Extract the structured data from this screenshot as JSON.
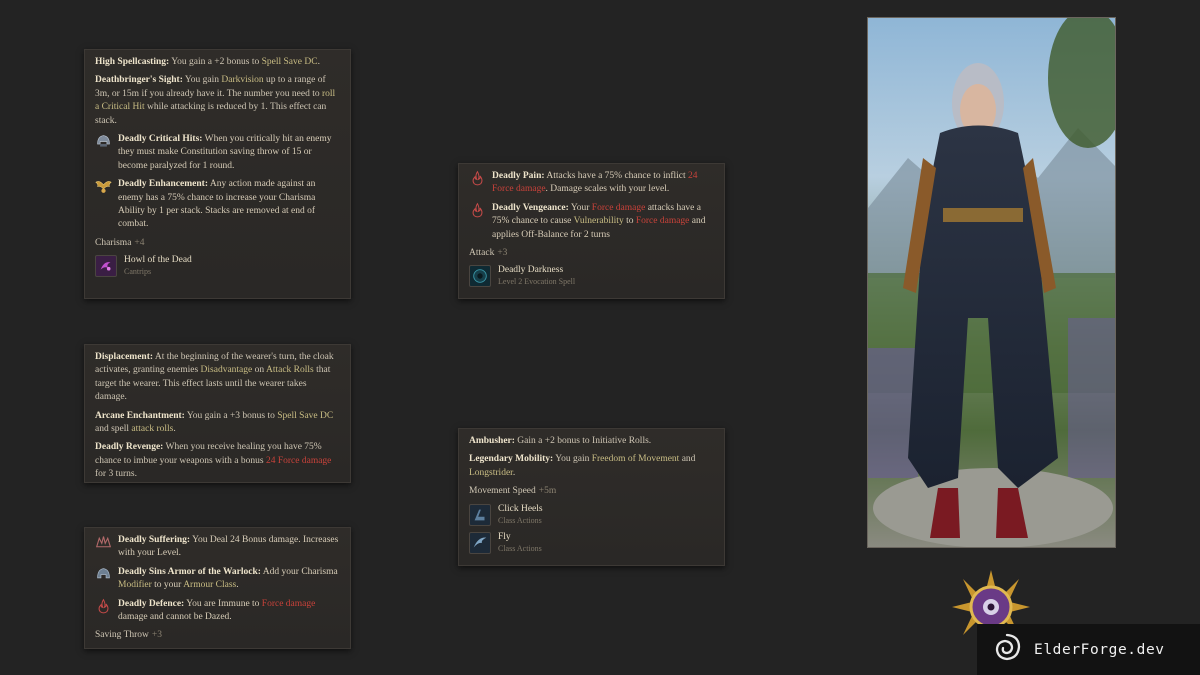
{
  "colors": {
    "background": "#232323",
    "panel": "#2c2a27",
    "highlight": "#c9bd84",
    "damage_red": "#c8423a",
    "title": "#efe5cc"
  },
  "panel1": {
    "high_spellcasting": {
      "name": "High Spellcasting:",
      "t1": " You gain a +2 bonus to ",
      "h1": "Spell Save DC",
      "t2": "."
    },
    "deathbringer": {
      "name": "Deathbringer's Sight:",
      "t1": " You gain ",
      "h1": "Darkvision",
      "t2": " up to a range of 3m, or 15m if you already have it. The number you need to ",
      "h2": "roll a Critical Hit",
      "t3": " while attacking is reduced by 1. This effect can stack."
    },
    "critical": {
      "icon": "helmet-icon",
      "name": "Deadly Critical Hits:",
      "t1": " When you critically hit an enemy they must make Constitution saving throw of 15 or become paralyzed for 1 round."
    },
    "enhancement": {
      "icon": "golden-wings-icon",
      "name": "Deadly Enhancement:",
      "t1": " Any action made against an enemy has a 75% chance to increase your Charisma Ability by 1 per stack. Stacks are removed at end of combat."
    },
    "stat": {
      "label": "Charisma",
      "bonus": "+4"
    },
    "spell": {
      "icon": "howl-of-the-dead-icon",
      "name": "Howl of the Dead",
      "sub": "Cantrips"
    }
  },
  "panel2": {
    "displacement": {
      "name": "Displacement:",
      "t1": " At the beginning of the wearer's turn, the cloak activates, granting enemies ",
      "h1": "Disadvantage",
      "t2": " on ",
      "h2": "Attack Rolls",
      "t3": " that target the wearer. This effect lasts until the wearer takes damage."
    },
    "arcane": {
      "name": "Arcane Enchantment:",
      "t1": " You gain a +3 bonus to ",
      "h1": "Spell Save DC",
      "t2": " and spell ",
      "h2": "attack rolls",
      "t3": "."
    },
    "revenge": {
      "name": "Deadly Revenge:",
      "t1": " When you receive healing you have 75% chance to imbue your weapons with a bonus ",
      "r1": "24 Force damage",
      "t2": " for 3 turns."
    }
  },
  "panel3": {
    "suffering": {
      "icon": "spiked-crown-icon",
      "name": "Deadly Suffering:",
      "t1": " You Deal 24 Bonus damage. Increases with your Level."
    },
    "sins": {
      "icon": "armor-helm-icon",
      "name": "Deadly Sins Armor of the Warlock:",
      "t1": " Add your Charisma ",
      "h1": "Modifier",
      "t2": " to your ",
      "h2": "Armour Class",
      "t3": "."
    },
    "defence": {
      "icon": "red-flame-icon",
      "name": "Deadly Defence:",
      "t1": " You are Immune to ",
      "r1": "Force damage",
      "t2": " damage and cannot be Dazed."
    },
    "stat": {
      "label": "Saving Throw",
      "bonus": "+3"
    }
  },
  "panel4": {
    "pain": {
      "icon": "red-flame-icon",
      "name": "Deadly Pain:",
      "t1": " Attacks have a 75% chance to inflict ",
      "r1": "24 Force damage",
      "t2": ". Damage scales with your level."
    },
    "vengeance": {
      "icon": "red-flame-icon",
      "name": "Deadly Vengeance:",
      "t1": " Your ",
      "r1": "Force damage",
      "t2": " attacks have a 75% chance to cause ",
      "h1": "Vulnerability",
      "t3": " to ",
      "r2": "Force damage",
      "t4": " and applies Off-Balance for 2 turns"
    },
    "stat": {
      "label": "Attack",
      "bonus": "+3"
    },
    "spell": {
      "icon": "deadly-darkness-icon",
      "name": "Deadly Darkness",
      "sub": "Level 2 Evocation Spell"
    }
  },
  "panel5": {
    "ambusher": {
      "name": "Ambusher:",
      "t1": " Gain a +2 bonus to Initiative Rolls."
    },
    "mobility": {
      "name": "Legendary Mobility:",
      "t1": " You gain ",
      "h1": "Freedom of Movement",
      "t2": " and ",
      "h2": "Longstrider",
      "t3": "."
    },
    "stat": {
      "label": "Movement Speed",
      "bonus": "+5m"
    },
    "spells": [
      {
        "icon": "click-heels-icon",
        "name": "Click Heels",
        "sub": "Class Actions"
      },
      {
        "icon": "fly-icon",
        "name": "Fly",
        "sub": "Class Actions"
      }
    ]
  },
  "brand": {
    "text": "ElderForge.dev",
    "icon": "swirl-logo-icon"
  }
}
